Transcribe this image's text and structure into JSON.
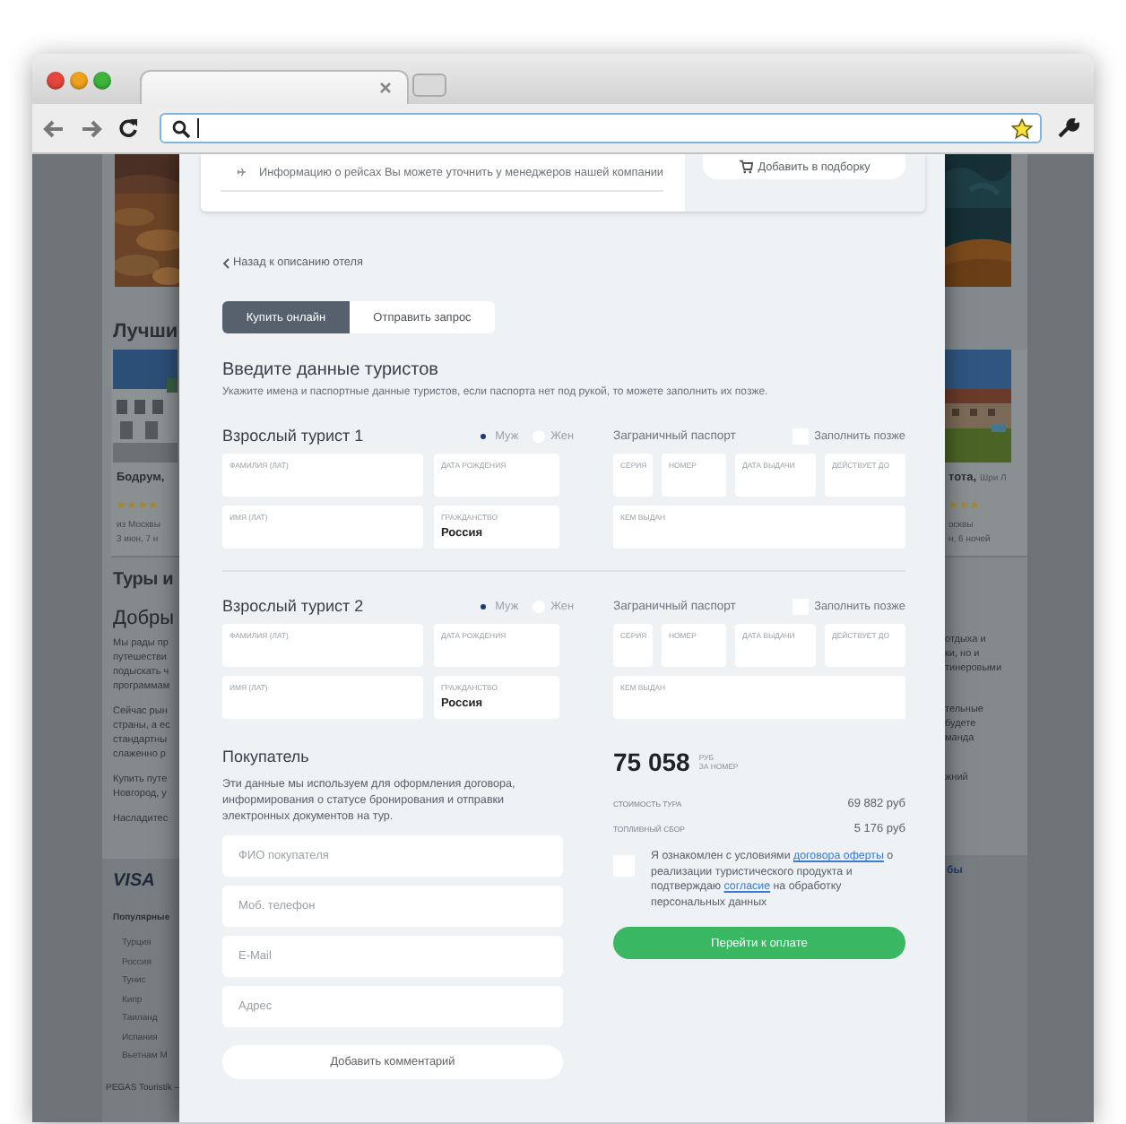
{
  "top_card": {
    "info": "Информацию о рейсах Вы можете уточнить у менеджеров нашей компании",
    "button": "Добавить в подборку"
  },
  "back_link": "Назад к описанию отеля",
  "mode_tabs": [
    {
      "label": "Купить онлайн",
      "selected": true
    },
    {
      "label": "Отправить запрос",
      "selected": false
    }
  ],
  "tourists_section": {
    "title": "Введите данные туристов",
    "hint": "Укажите имена и паспортные данные туристов, если паспорта нет под рукой, то можете заполнить их позже."
  },
  "tourists": [
    {
      "title": "Взрослый турист 1",
      "gender": [
        {
          "label": "Муж",
          "selected": true
        },
        {
          "label": "Жен",
          "selected": false
        }
      ],
      "fields": [
        {
          "label": "ФАМИЛИЯ (ЛАТ)"
        },
        {
          "label": "ДАТА РОЖДЕНИЯ"
        },
        {
          "label": "ИМЯ (ЛАТ)"
        },
        {
          "label": "ГРАЖДАНСТВО",
          "value": "Россия"
        }
      ],
      "passport": {
        "title": "Заграничный паспорт",
        "fill_later": {
          "label": "Заполнить позже",
          "checked": false
        },
        "fields": [
          {
            "label": "СЕРИЯ"
          },
          {
            "label": "НОМЕР"
          },
          {
            "label": "ДАТА ВЫДАЧИ"
          },
          {
            "label": "ДЕЙСТВУЕТ ДО"
          },
          {
            "label": "КЕМ ВЫДАН"
          }
        ]
      }
    },
    {
      "title": "Взрослый турист 2",
      "gender": [
        {
          "label": "Муж",
          "selected": true
        },
        {
          "label": "Жен",
          "selected": false
        }
      ],
      "fields": [
        {
          "label": "ФАМИЛИЯ (ЛАТ)"
        },
        {
          "label": "ДАТА РОЖДЕНИЯ"
        },
        {
          "label": "ИМЯ (ЛАТ)"
        },
        {
          "label": "ГРАЖДАНСТВО",
          "value": "Россия"
        }
      ],
      "passport": {
        "title": "Заграничный паспорт",
        "fill_later": {
          "label": "Заполнить позже",
          "checked": false
        },
        "fields": [
          {
            "label": "СЕРИЯ"
          },
          {
            "label": "НОМЕР"
          },
          {
            "label": "ДАТА ВЫДАЧИ"
          },
          {
            "label": "ДЕЙСТВУЕТ ДО"
          },
          {
            "label": "КЕМ ВЫДАН"
          }
        ]
      }
    }
  ],
  "buyer": {
    "title": "Покупатель",
    "description": "Эти данные мы используем для оформления договора, информирования о статусе бронирования и отправки электронных документов на тур.",
    "fields": [
      {
        "placeholder": "ФИО покупателя"
      },
      {
        "placeholder": "Моб. телефон"
      },
      {
        "placeholder": "E-Mail"
      },
      {
        "placeholder": "Адрес"
      }
    ],
    "comment_button": "Добавить комментарий"
  },
  "summary": {
    "price": "75 058",
    "currency": "РУБ",
    "unit": "ЗА НОМЕР",
    "rows": [
      {
        "label": "СТОИМОСТЬ ТУРА",
        "value": "69 882 руб"
      },
      {
        "label": "ТОПЛИВНЫЙ СБОР",
        "value": "5 176 руб"
      }
    ],
    "consent": {
      "checked": false,
      "parts": [
        {
          "kind": "text",
          "text": "Я ознакомлен с условиями "
        },
        {
          "kind": "link",
          "text": "договора оферты"
        },
        {
          "kind": "text",
          "text": " о реализации туристического продукта и подтверждаю "
        },
        {
          "kind": "link",
          "text": "согласие"
        },
        {
          "kind": "text",
          "text": " на обработку персональных данных"
        }
      ]
    },
    "pay_button": "Перейти к оплате"
  },
  "background_page": {
    "left": {
      "heading": "Лучши",
      "hotel": {
        "name": "Бодрум,",
        "stars": 4,
        "lines": [
          "из Москвы",
          "3 июн, 7 н"
        ]
      },
      "section_title": "Туры и",
      "subtitle": "Добры",
      "paragraphs": [
        [
          "Мы рады пр",
          "путешестви",
          "подыскать ч",
          "программам"
        ],
        [
          "Сейчас рын",
          "страны, а ес",
          "стандартны",
          "слаженно р"
        ],
        [
          "Купить путе",
          "Новгород, у"
        ],
        [
          "Насладитес"
        ]
      ]
    },
    "right": {
      "hotel": {
        "name": "тота,",
        "location": "Шри Л",
        "stars": 3,
        "lines": [
          "осквы",
          "н, 6 ночей"
        ]
      },
      "paragraphs": [
        [
          "отдыха и",
          "ки, но и",
          "тинеровыми"
        ],
        [
          "тельные",
          "будете",
          "манда"
        ],
        [
          "жний"
        ]
      ]
    },
    "footer": {
      "logo": "VISA",
      "heading": "Популярные",
      "links": [
        "Турция",
        "Россия",
        "Тунис",
        "Кипр",
        "Таиланд",
        "Испания",
        "Вьетнам М"
      ],
      "copyright": "PEGAS Touristik —",
      "right_links": [
        "бы"
      ]
    }
  }
}
